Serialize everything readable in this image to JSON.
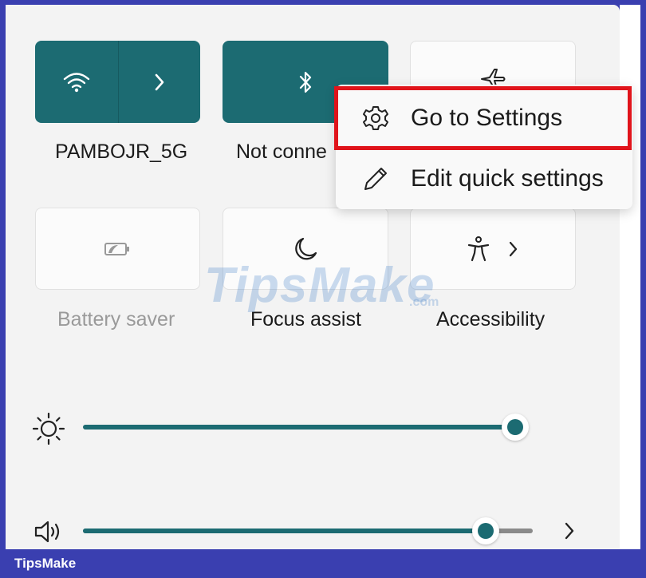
{
  "tiles": {
    "wifi": {
      "label": "PAMBOJR_5G",
      "icon": "wifi-icon",
      "expand_icon": "chevron-right-icon",
      "state": "on"
    },
    "bluetooth": {
      "label": "Not conne",
      "icon": "bluetooth-icon",
      "state": "on"
    },
    "airplane": {
      "label": "",
      "icon": "airplane-icon",
      "state": "off"
    },
    "battery_saver": {
      "label": "Battery saver",
      "icon": "battery-saver-icon",
      "state": "disabled"
    },
    "focus_assist": {
      "label": "Focus assist",
      "icon": "moon-icon",
      "state": "off"
    },
    "accessibility": {
      "label": "Accessibility",
      "icon": "accessibility-icon",
      "expand_icon": "chevron-right-icon",
      "state": "off"
    }
  },
  "context_menu": {
    "items": [
      {
        "label": "Go to Settings",
        "icon": "gear-icon",
        "highlighted": true
      },
      {
        "label": "Edit quick settings",
        "icon": "pencil-icon",
        "highlighted": false
      }
    ]
  },
  "sliders": {
    "brightness": {
      "icon": "sun-icon",
      "value": 0.99
    },
    "volume": {
      "icon": "speaker-icon",
      "value": 0.92,
      "expand_icon": "chevron-right-icon"
    }
  },
  "watermark": {
    "text": "TipsMake",
    "suffix": ".com"
  },
  "footer": {
    "brand": "TipsMake"
  },
  "colors": {
    "accent": "#1c6b72",
    "highlight_border": "#e0141b",
    "frame": "#3a3fb0"
  }
}
